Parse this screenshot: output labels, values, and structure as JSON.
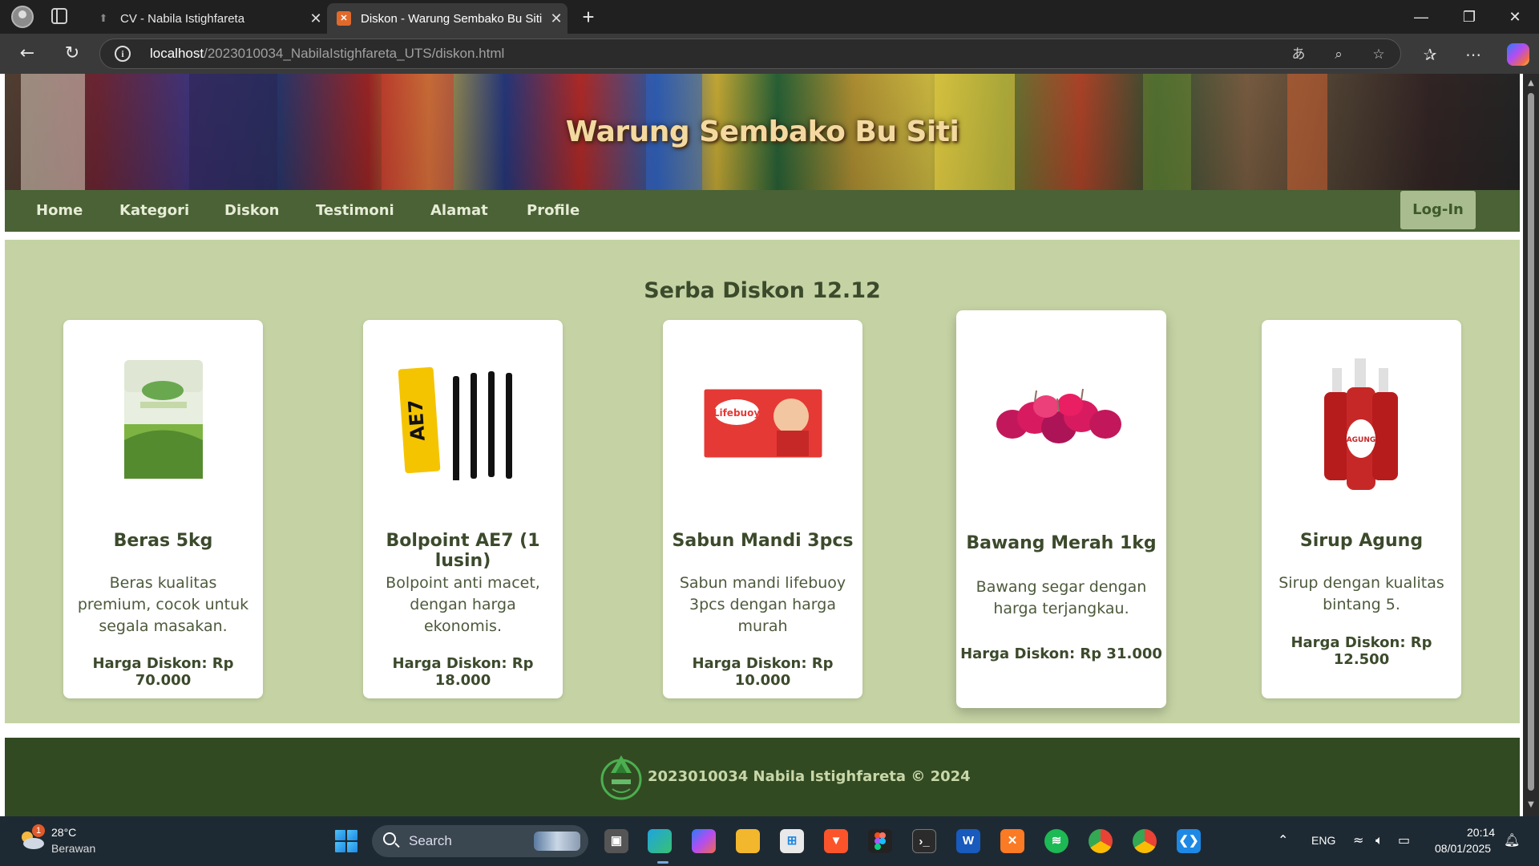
{
  "browser": {
    "tabs": [
      {
        "title": "CV - Nabila Istighfareta",
        "active": false
      },
      {
        "title": "Diskon - Warung Sembako Bu Siti",
        "active": true
      }
    ],
    "new_tab_glyph": "+",
    "window_controls": {
      "minimize": "—",
      "restore": "❐",
      "close": "✕"
    },
    "url_host": "localhost",
    "url_path": "/2023010034_NabilaIstighfareta_UTS/diskon.html"
  },
  "site": {
    "banner_title": "Warung Sembako Bu Siti",
    "nav": {
      "items": [
        "Home",
        "Kategori",
        "Diskon",
        "Testimoni",
        "Alamat",
        "Profile"
      ],
      "login_label": "Log-In"
    },
    "section_title": "Serba Diskon 12.12",
    "products": [
      {
        "name": "Beras 5kg",
        "desc": "Beras kualitas premium, cocok untuk segala masakan.",
        "price": "Harga Diskon: Rp 70.000",
        "icon": "rice-bag-image"
      },
      {
        "name": "Bolpoint AE7 (1 lusin)",
        "desc": "Bolpoint anti macet, dengan harga ekonomis.",
        "price": "Harga Diskon: Rp 18.000",
        "icon": "pens-image"
      },
      {
        "name": "Sabun Mandi 3pcs",
        "desc": "Sabun mandi lifebuoy 3pcs dengan harga murah",
        "price": "Harga Diskon: Rp 10.000",
        "icon": "soap-image"
      },
      {
        "name": "Bawang Merah 1kg",
        "desc": "Bawang segar dengan harga terjangkau.",
        "price": "Harga Diskon: Rp 31.000",
        "icon": "shallots-image"
      },
      {
        "name": "Sirup Agung",
        "desc": "Sirup dengan kualitas bintang 5.",
        "price": "Harga Diskon: Rp 12.500",
        "icon": "syrup-bottles-image"
      }
    ],
    "footer_text": "2023010034 Nabila Istighfareta © 2024"
  },
  "taskbar": {
    "weather_badge": "1",
    "weather_temp": "28°C",
    "weather_desc": "Berawan",
    "search_label": "Search",
    "language": "ENG",
    "time": "20:14",
    "date": "08/01/2025"
  },
  "colors": {
    "nav_bg": "#4a6235",
    "main_bg": "#c5d3a4",
    "footer_bg": "#324a22",
    "login_bg": "#a9bc8f",
    "heading_text": "#3c4a2c"
  }
}
